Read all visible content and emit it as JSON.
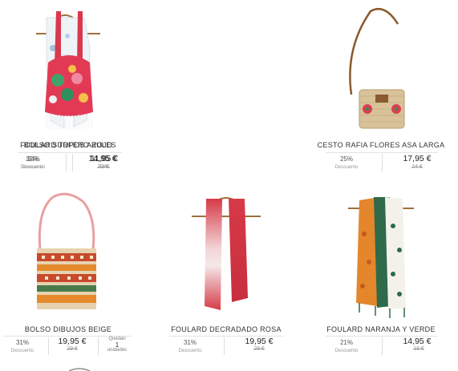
{
  "products": [
    {
      "name": "FOULARD TOPOS AZULES",
      "discount": "34%",
      "discount_label": "Descuento",
      "price": "11,95 €",
      "old_price": "18 €"
    },
    {
      "name": "BOLSO SURFERO ROJO",
      "discount": "32%",
      "discount_label": "Descuento",
      "price": "14,95 €",
      "old_price": "22 €"
    },
    {
      "name": "CESTO RAFIA FLORES ASA LARGA",
      "discount": "25%",
      "discount_label": "Descuento",
      "price": "17,95 €",
      "old_price": "24 €"
    },
    {
      "name": "BOLSO DIBUJOS BEIGE",
      "discount": "31%",
      "discount_label": "Descuento",
      "price": "19,95 €",
      "old_price": "29 €",
      "stock_top": "Quedan",
      "stock_num": "1",
      "stock_bottom": "unidades"
    },
    {
      "name": "FOULARD DECRADADO ROSA",
      "discount": "31%",
      "discount_label": "Descuento",
      "price": "19,95 €",
      "old_price": "29 €"
    },
    {
      "name": "FOULARD NARANJA Y VERDE",
      "discount": "21%",
      "discount_label": "Descuento",
      "price": "14,95 €",
      "old_price": "19 €"
    }
  ],
  "colors": {
    "text": "#333333",
    "strike": "#999999",
    "separator": "#e2e2e2"
  }
}
